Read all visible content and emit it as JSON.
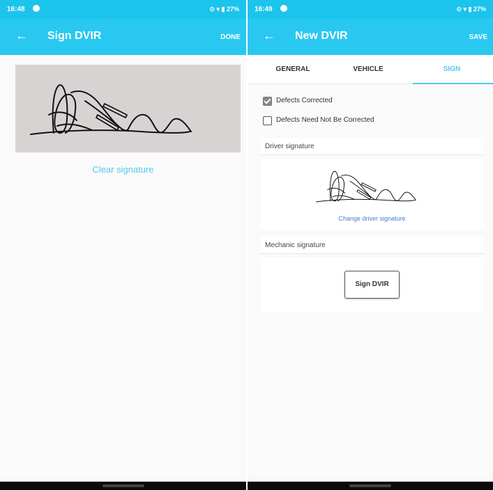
{
  "left_screen": {
    "status_bar": {
      "time": "16:48",
      "right": "⊙ ▾ ▮ 27%"
    },
    "app_bar": {
      "back_icon": "arrow-left-icon",
      "title": "Sign DVIR",
      "action": "DONE"
    },
    "clear_link": "Clear signature"
  },
  "right_screen": {
    "status_bar": {
      "time": "16:49",
      "right": "⊙ ▾ ▮ 27%"
    },
    "app_bar": {
      "back_icon": "arrow-left-icon",
      "title": "New DVIR",
      "action": "SAVE"
    },
    "tabs": [
      {
        "label": "GENERAL",
        "active": false
      },
      {
        "label": "VEHICLE",
        "active": false
      },
      {
        "label": "SIGN",
        "active": true
      }
    ],
    "checkboxes": [
      {
        "label": "Defects Corrected",
        "checked": true
      },
      {
        "label": "Defects Need Not Be Corrected",
        "checked": false
      }
    ],
    "driver_signature": {
      "header": "Driver signature",
      "change_link": "Change driver signature"
    },
    "mechanic_signature": {
      "header": "Mechanic signature",
      "button": "Sign DVIR"
    }
  },
  "colors": {
    "status_bar": "#1bc4ec",
    "app_bar": "#29c8f0",
    "accent": "#4dcbee",
    "signature_canvas": "#d7d3d3",
    "link_blue": "#4a7bd0"
  }
}
